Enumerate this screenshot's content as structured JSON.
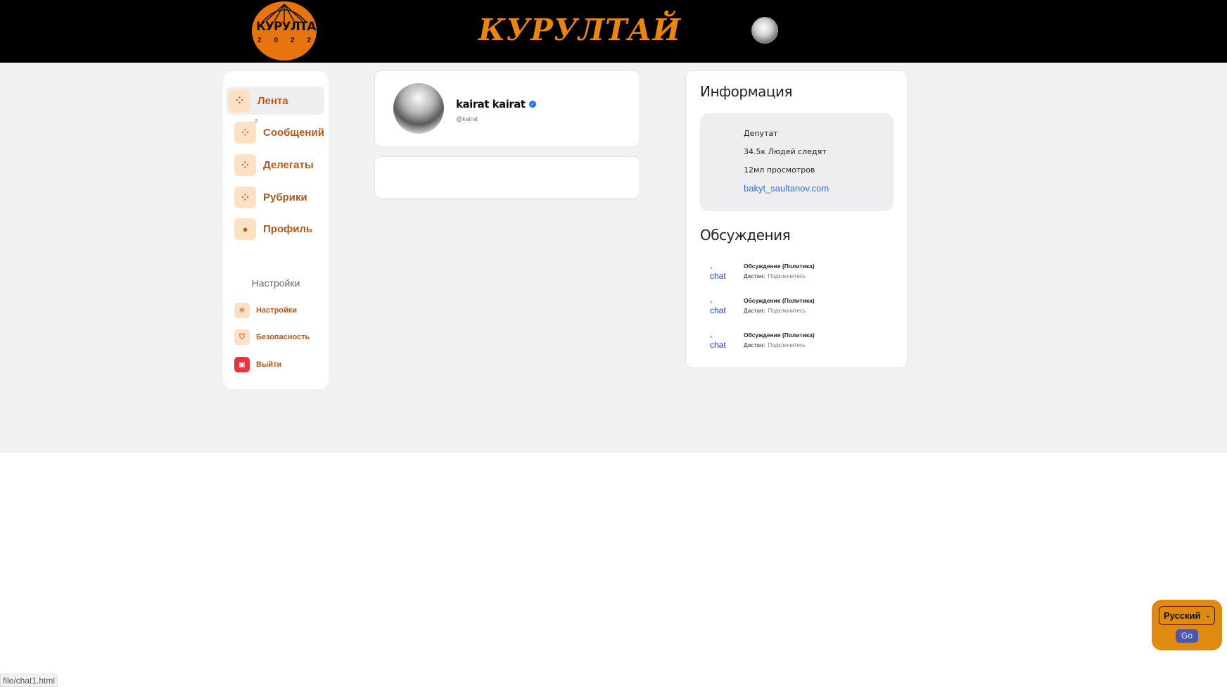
{
  "header": {
    "logo_word": "КУРУЛТАЙ",
    "logo_year": [
      "2",
      "0",
      "2",
      "2"
    ],
    "brand_title": "КУРУЛТАЙ"
  },
  "sidebar": {
    "items": [
      {
        "label": "Лента",
        "icon": "grid-dots-icon",
        "active": true
      },
      {
        "label": "Сообщений",
        "icon": "grid-dots-icon",
        "badge": "2"
      },
      {
        "label": "Делегаты",
        "icon": "grid-dots-icon"
      },
      {
        "label": "Рубрики",
        "icon": "grid-dots-icon"
      },
      {
        "label": "Профиль",
        "icon": "user-icon"
      }
    ],
    "settings_title": "Настройки",
    "settings_items": [
      {
        "label": "Настройки",
        "icon": "gear-icon"
      },
      {
        "label": "Безопасность",
        "icon": "shield-icon"
      },
      {
        "label": "Выйти",
        "icon": "logout-icon"
      }
    ]
  },
  "profile": {
    "name": "kairat kairat",
    "handle": "@kairat"
  },
  "info": {
    "title": "Информация",
    "role": "Депутат",
    "followers": "34.5к Людей следят",
    "views": "12мл просмотров",
    "website": "bakyt_saultanov.com"
  },
  "discussions": {
    "title": "Обсуждения",
    "items": [
      {
        "img_alt": "chat",
        "title": "Обсуждение (Политика)",
        "label": "Дастан:",
        "action": "Подключитесь"
      },
      {
        "img_alt": "chat",
        "title": "Обсуждение (Политика)",
        "label": "Дастан:",
        "action": "Подключитесь"
      },
      {
        "img_alt": "chat",
        "title": "Обсуждение (Политика)",
        "label": "Дастан:",
        "action": "Подключитесь"
      }
    ]
  },
  "language": {
    "selected": "Русский",
    "go_label": "Go"
  },
  "status_bar": {
    "url": "file/chat1.html"
  },
  "colors": {
    "accent_orange": "#e8740f",
    "nav_text": "#b5581a",
    "link_blue": "#2f6fd6",
    "danger_red": "#e9343b"
  }
}
